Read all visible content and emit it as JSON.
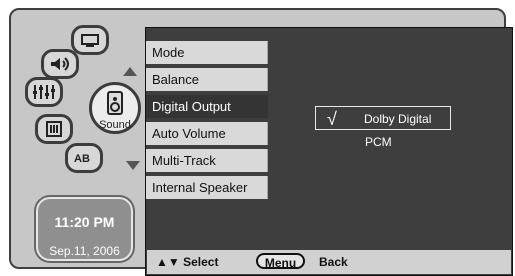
{
  "sidebar": {
    "hub_label": "Sound",
    "clock_time": "11:20 PM",
    "clock_date": "Sep.11, 2006"
  },
  "menu": {
    "items": [
      {
        "label": "Mode"
      },
      {
        "label": "Balance"
      },
      {
        "label": "Digital Output"
      },
      {
        "label": "Auto Volume"
      },
      {
        "label": "Multi-Track"
      },
      {
        "label": "Internal Speaker"
      }
    ]
  },
  "digital_output": {
    "selected_check": "√",
    "options": [
      "Dolby Digital",
      "PCM"
    ]
  },
  "footer": {
    "nav_hint": "▲▼ Select",
    "menu_button": "Menu",
    "back_label": "Back"
  },
  "icons": [
    "tv-icon",
    "speaker-icon",
    "equalizer-icon",
    "settings-icon",
    "ab-icon",
    "up-arrow-icon",
    "down-arrow-icon"
  ]
}
